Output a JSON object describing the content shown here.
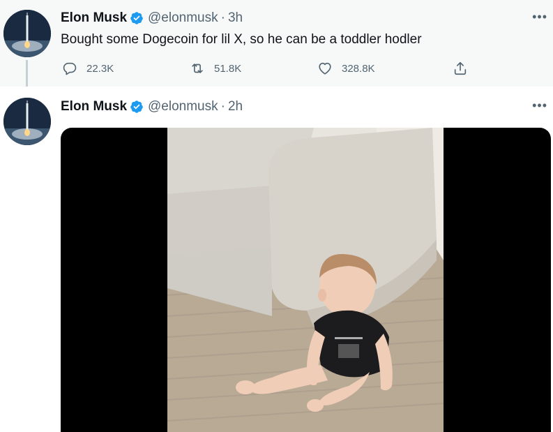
{
  "tweets": [
    {
      "author": {
        "name": "Elon Musk",
        "handle": "@elonmusk",
        "verified": true
      },
      "time": "3h",
      "text": "Bought some Dogecoin for lil X, so he can be a toddler hodler",
      "stats": {
        "replies": "22.3K",
        "retweets": "51.8K",
        "likes": "328.8K"
      }
    },
    {
      "author": {
        "name": "Elon Musk",
        "handle": "@elonmusk",
        "verified": true
      },
      "time": "2h",
      "media": {
        "type": "video",
        "subject": "baby sitting on rug beside a sofa"
      }
    }
  ],
  "colors": {
    "verified_blue": "#1d9bf0",
    "secondary_text": "#536471",
    "thread_line": "#c4cfd6",
    "highlight_bg": "#f7f9f9"
  },
  "icons": [
    "reply-icon",
    "retweet-icon",
    "like-icon",
    "share-icon",
    "more-icon",
    "verified-badge-icon"
  ]
}
